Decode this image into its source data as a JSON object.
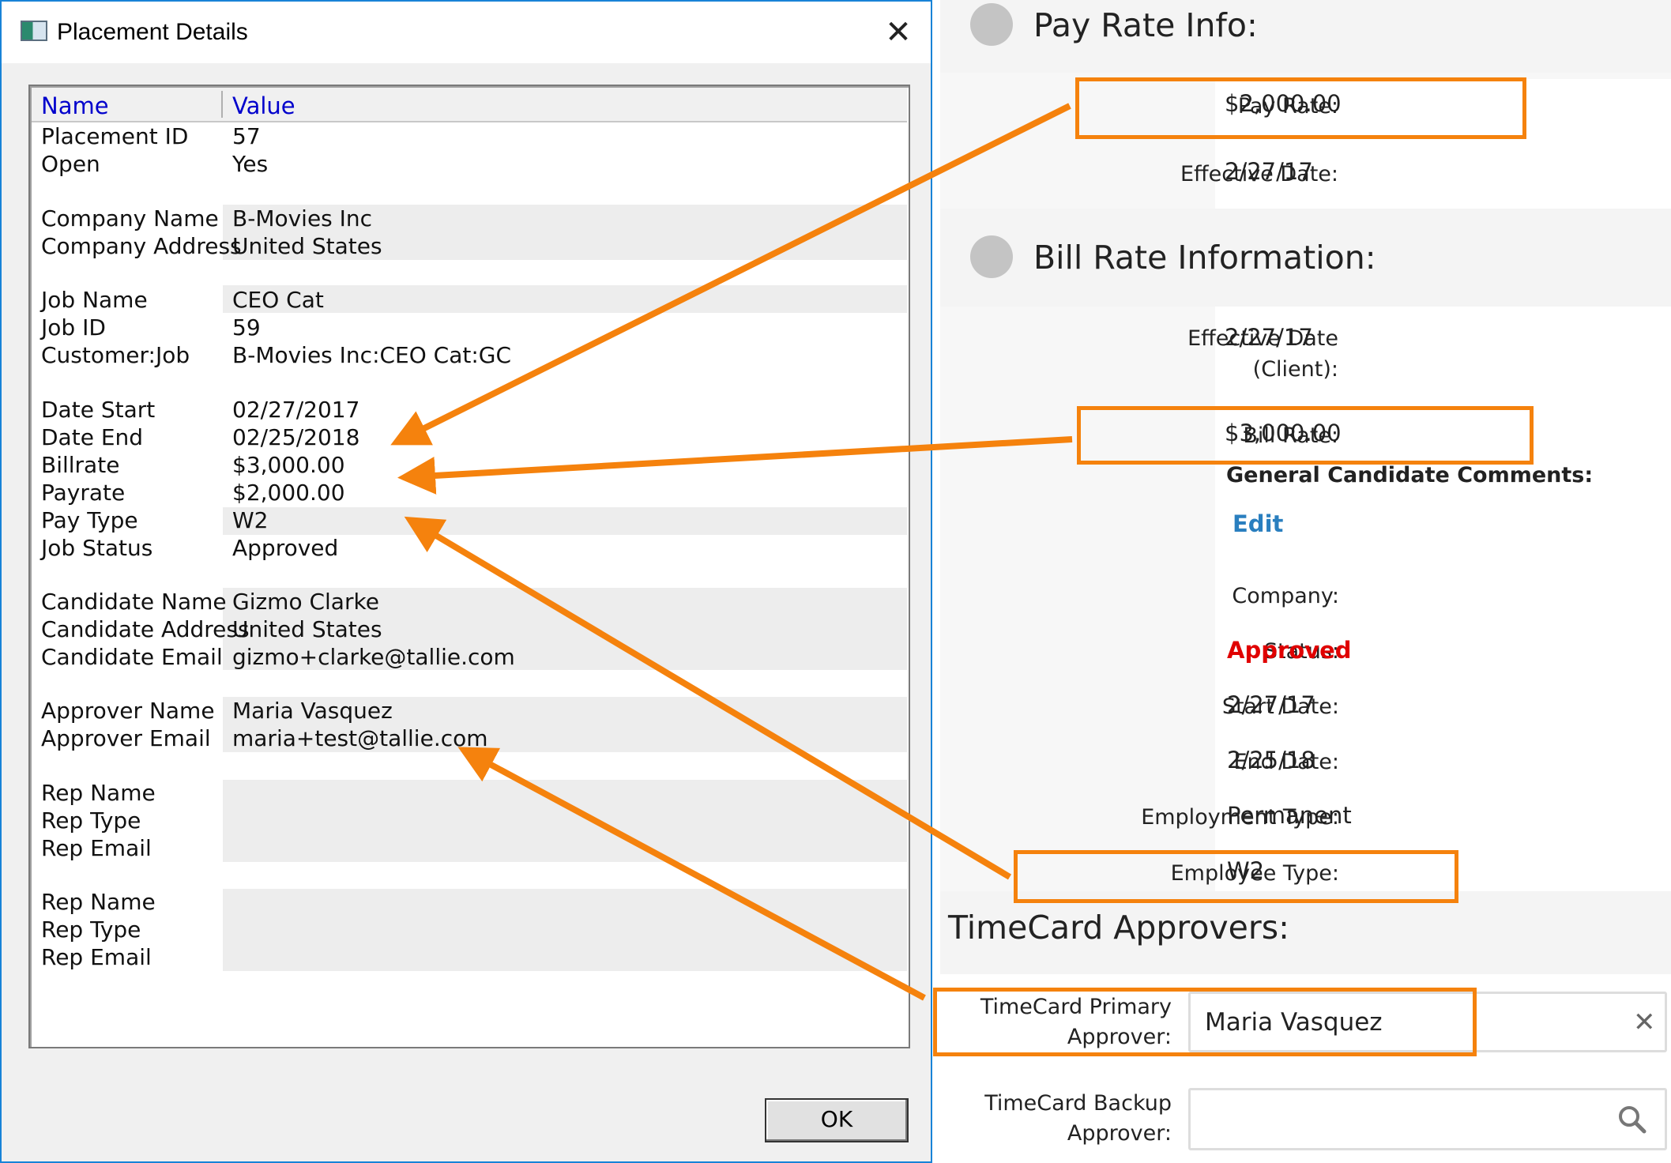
{
  "dialog": {
    "title": "Placement Details",
    "close_glyph": "✕",
    "columns": {
      "name": "Name",
      "value": "Value"
    },
    "rows": [
      {
        "name": "Placement ID",
        "value": "57"
      },
      {
        "name": "Open",
        "value": "Yes"
      },
      {
        "name": "Company Name",
        "value": "B-Movies Inc"
      },
      {
        "name": "Company Address",
        "value": "United States"
      },
      {
        "name": "Job Name",
        "value": "CEO Cat"
      },
      {
        "name": "Job ID",
        "value": "59"
      },
      {
        "name": "Customer:Job",
        "value": "B-Movies Inc:CEO Cat:GC"
      },
      {
        "name": "Date Start",
        "value": "02/27/2017"
      },
      {
        "name": "Date End",
        "value": "02/25/2018"
      },
      {
        "name": "Billrate",
        "value": "$3,000.00"
      },
      {
        "name": "Payrate",
        "value": "$2,000.00"
      },
      {
        "name": "Pay Type",
        "value": "W2"
      },
      {
        "name": "Job Status",
        "value": "Approved"
      },
      {
        "name": "Candidate Name",
        "value": "Gizmo Clarke"
      },
      {
        "name": "Candidate Address",
        "value": "United States"
      },
      {
        "name": "Candidate Email",
        "value": "gizmo+clarke@tallie.com"
      },
      {
        "name": "Approver Name",
        "value": "Maria Vasquez"
      },
      {
        "name": "Approver Email",
        "value": "maria+test@tallie.com"
      },
      {
        "name": "Rep Name",
        "value": ""
      },
      {
        "name": "Rep Type",
        "value": ""
      },
      {
        "name": "Rep Email",
        "value": ""
      },
      {
        "name": "Rep Name",
        "value": ""
      },
      {
        "name": "Rep Type",
        "value": ""
      },
      {
        "name": "Rep Email",
        "value": ""
      }
    ],
    "ok_label": "OK"
  },
  "web": {
    "pay_section": {
      "title": "Pay Rate Info:",
      "pay_rate_label": "Pay Rate:",
      "pay_rate_value": "$2,000.00",
      "effective_date_label": "Effective Date:",
      "effective_date_value": "2/27/17"
    },
    "bill_section": {
      "title": "Bill Rate Information:",
      "effective_date_label_1": "Effective Date",
      "effective_date_label_2": "(Client):",
      "effective_date_value": "2/27/17",
      "bill_rate_label": "Bill Rate:",
      "bill_rate_value": "$3,000.00",
      "comments_label": "General Candidate Comments:",
      "edit_link": "Edit",
      "company_label": "Company:",
      "status_label": "Status:",
      "status_value": "Approved",
      "start_date_label": "Start Date:",
      "start_date_value": "2/27/17",
      "end_date_label": "End Date:",
      "end_date_value": "2/25/18",
      "employment_type_label": "Employment Type:",
      "employment_type_value": "Permanent",
      "employee_type_label": "Employee Type:",
      "employee_type_value": "W2"
    },
    "approvers_section": {
      "title": "TimeCard Approvers:",
      "primary_label_1": "TimeCard Primary",
      "primary_label_2": "Approver:",
      "primary_value": "Maria Vasquez",
      "clear_glyph": "✕",
      "backup_label_1": "TimeCard Backup",
      "backup_label_2": "Approver:",
      "backup_value": ""
    }
  },
  "colors": {
    "highlight": "#f5820d",
    "status_approved": "#e00000",
    "link": "#2a7fbf",
    "header_text": "#0000cc"
  }
}
